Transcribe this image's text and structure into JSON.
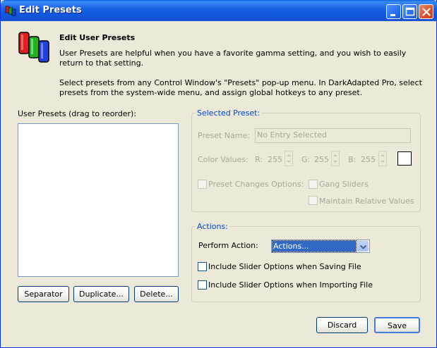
{
  "window": {
    "title": "Edit Presets",
    "controls": {
      "minimize": "minimize-icon",
      "maximize": "maximize-icon",
      "close": "close-icon"
    }
  },
  "header": {
    "heading": "Edit User Presets",
    "paragraph1": "User Presets are helpful when you have a favorite gamma setting, and you wish to easily return to that setting.",
    "paragraph2": "Select presets from any Control Window's \"Presets\" pop-up menu. In DarkAdapted Pro, select presets from the system-wide menu, and assign global hotkeys to any preset."
  },
  "presets": {
    "label": "User Presets (drag to reorder):",
    "items": [],
    "buttons": {
      "separator": "Separator",
      "duplicate": "Duplicate...",
      "delete": "Delete..."
    }
  },
  "selected_preset": {
    "title": "Selected Preset:",
    "name_label": "Preset Name:",
    "name_value": "No Entry Selected",
    "color_label": "Color Values:",
    "r_label": "R:",
    "r_value": "255",
    "g_label": "G:",
    "g_value": "255",
    "b_label": "B:",
    "b_value": "255",
    "swatch_color": "#ffffff",
    "changes_label": "Preset Changes Options:",
    "gang_label": "Gang Sliders",
    "maintain_label": "Maintain Relative Values"
  },
  "actions": {
    "title": "Actions:",
    "perform_label": "Perform Action:",
    "perform_value": "Actions...",
    "include_saving": "Include Slider Options when Saving File",
    "include_importing": "Include Slider Options when Importing File"
  },
  "footer": {
    "discard": "Discard",
    "save": "Save"
  },
  "colors": {
    "titlebar": "#0f56dd",
    "dialog_bg": "#ece9d8",
    "group_title": "#0046d5",
    "disabled_text": "#aca899",
    "selection": "#316ac5"
  }
}
